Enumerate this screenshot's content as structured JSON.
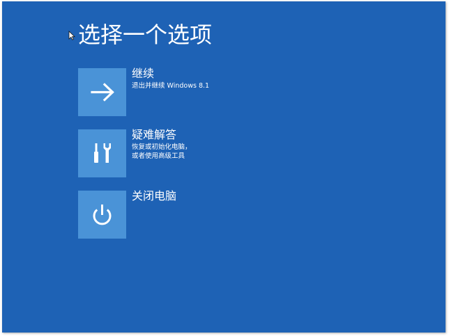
{
  "screen": {
    "title": "选择一个选项",
    "background_color": "#1e62b5",
    "tile_color": "#4a93d7"
  },
  "options": [
    {
      "title": "继续",
      "description": [
        "退出并继续 Windows 8.1"
      ],
      "icon": "arrow-right-icon"
    },
    {
      "title": "疑难解答",
      "description": [
        "恢复或初始化电脑，",
        "或者使用高级工具"
      ],
      "icon": "tools-icon"
    },
    {
      "title": "关闭电脑",
      "description": [],
      "icon": "power-icon"
    }
  ]
}
